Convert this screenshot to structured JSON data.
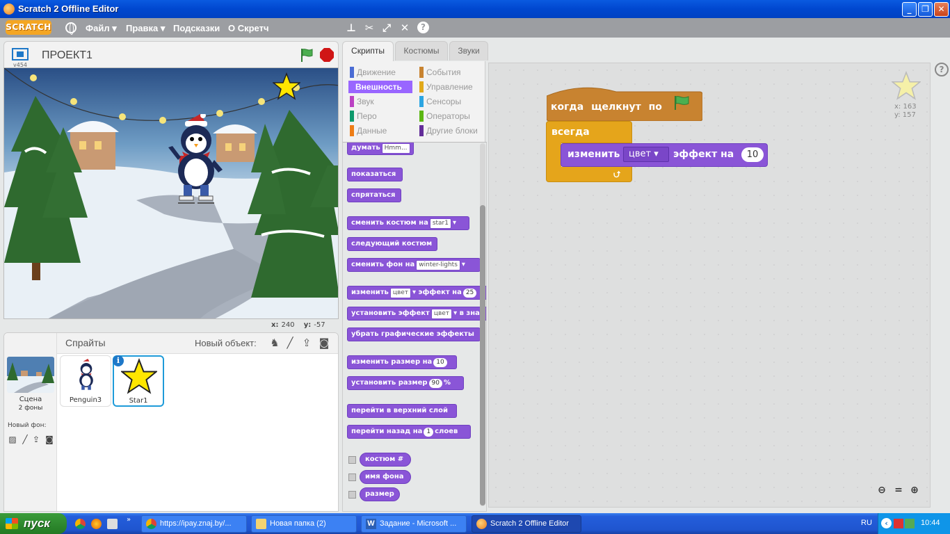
{
  "window": {
    "title": "Scratch 2 Offline Editor"
  },
  "menubar": {
    "logo": "SCRATCH",
    "items": [
      "Файл ▾",
      "Правка ▾",
      "Подсказки",
      "О Скретч"
    ]
  },
  "stage": {
    "version": "v454",
    "project_title": "ПРОЕКТ1",
    "coords": {
      "x_label": "x:",
      "x": "240",
      "y_label": "y:",
      "y": "-57"
    }
  },
  "sprites": {
    "title": "Спрайты",
    "new_sprite": "Новый объект:",
    "stage_label": "Сцена",
    "stage_sub": "2 фоны",
    "new_backdrop": "Новый фон:",
    "items": [
      {
        "name": "Penguin3"
      },
      {
        "name": "Star1"
      }
    ]
  },
  "tabs": [
    "Скрипты",
    "Костюмы",
    "Звуки"
  ],
  "categories": [
    {
      "label": "Движение",
      "color": "#4a6cd4"
    },
    {
      "label": "Внешность",
      "color": "#8a55d7"
    },
    {
      "label": "Звук",
      "color": "#bb42c3"
    },
    {
      "label": "Перо",
      "color": "#0e9a6c"
    },
    {
      "label": "Данные",
      "color": "#ee7d16"
    },
    {
      "label": "События",
      "color": "#c88330"
    },
    {
      "label": "Управление",
      "color": "#e1a91a"
    },
    {
      "label": "Сенсоры",
      "color": "#2ca5e2"
    },
    {
      "label": "Операторы",
      "color": "#5cb712"
    },
    {
      "label": "Другие блоки",
      "color": "#632d99"
    }
  ],
  "palette": {
    "think": {
      "text": "думать",
      "arg": "Hmm..."
    },
    "show": "показаться",
    "hide": "спрятаться",
    "switch_costume": {
      "text": "сменить костюм на",
      "arg": "star1"
    },
    "next_costume": "следующий костюм",
    "switch_backdrop": {
      "text": "сменить фон на",
      "arg": "winter-lights"
    },
    "change_effect": {
      "t1": "изменить",
      "arg": "цвет",
      "t2": "эффект на",
      "num": "25"
    },
    "set_effect": {
      "t1": "установить эффект",
      "arg": "цвет",
      "t2": "в зна"
    },
    "clear_effects": "убрать графические эффекты",
    "change_size": {
      "text": "изменить размер на",
      "num": "10"
    },
    "set_size": {
      "text": "установить размер",
      "num": "90",
      "unit": "%"
    },
    "front": "перейти в верхний слой",
    "back": {
      "t1": "перейти назад на",
      "num": "1",
      "t2": "слоев"
    },
    "costume_num": "костюм #",
    "backdrop_name": "имя фона",
    "size": "размер"
  },
  "script": {
    "hat": "когда щелкнут по",
    "forever": "всегда",
    "change": {
      "t1": "изменить",
      "arg": "цвет",
      "t2": "эффект на",
      "num": "10"
    },
    "sprite_x": "x: 163",
    "sprite_y": "y: 157"
  },
  "taskbar": {
    "start": "пуск",
    "tasks": [
      "https://ipay.znaj.by/...",
      "Новая папка (2)",
      "Задание - Microsoft ...",
      "Scratch 2 Offline Editor"
    ],
    "lang": "RU",
    "time": "10:44"
  }
}
